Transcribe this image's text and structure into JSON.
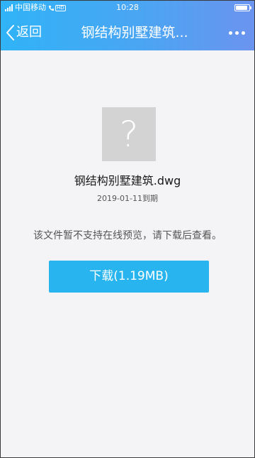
{
  "status_bar": {
    "carrier": "中国移动",
    "call_badge": "HD",
    "time": "10:28",
    "battery_level": 0.9
  },
  "nav": {
    "back_label": "返回",
    "title": "钢结构别墅建筑..."
  },
  "file": {
    "icon_glyph": "?",
    "name": "钢结构别墅建筑.dwg",
    "expire": "2019-01-11到期",
    "notice": "该文件暂不支持在线预览，请下载后查看。",
    "download_label": "下载(1.19MB)"
  },
  "colors": {
    "accent": "#28b5ef",
    "header_start": "#30b3f7",
    "header_end": "#6b94ef",
    "background": "#f4f4f6"
  }
}
